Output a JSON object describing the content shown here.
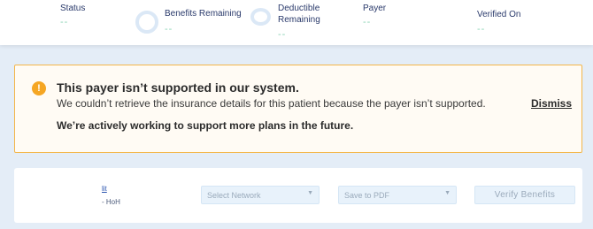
{
  "summary": {
    "status_label": "Status",
    "status_value": "--",
    "benefits_label": "Benefits Remaining",
    "benefits_value": "--",
    "deductible_label_line1": "Deductible",
    "deductible_label_line2": "Remaining",
    "deductible_value": "--",
    "payer_label": "Payer",
    "payer_value": "--",
    "verified_label": "Verified On",
    "verified_value": "--"
  },
  "alert": {
    "icon": "!",
    "title": "This payer isn’t supported in our system.",
    "message": "We couldn’t retrieve the insurance details for this patient because the payer isn’t supported.",
    "dismiss": "Dismiss",
    "note": "We’re actively working to support more plans in the future."
  },
  "card": {
    "link_text": "lit",
    "sub_text": "- HoH",
    "network_placeholder": "Select Network",
    "save_placeholder": "Save to PDF",
    "verify_label": "Verify Benefits"
  },
  "colors": {
    "accent_warning": "#f5a623",
    "value_green": "#8ad3b4",
    "label_navy": "#2a3a6b"
  }
}
